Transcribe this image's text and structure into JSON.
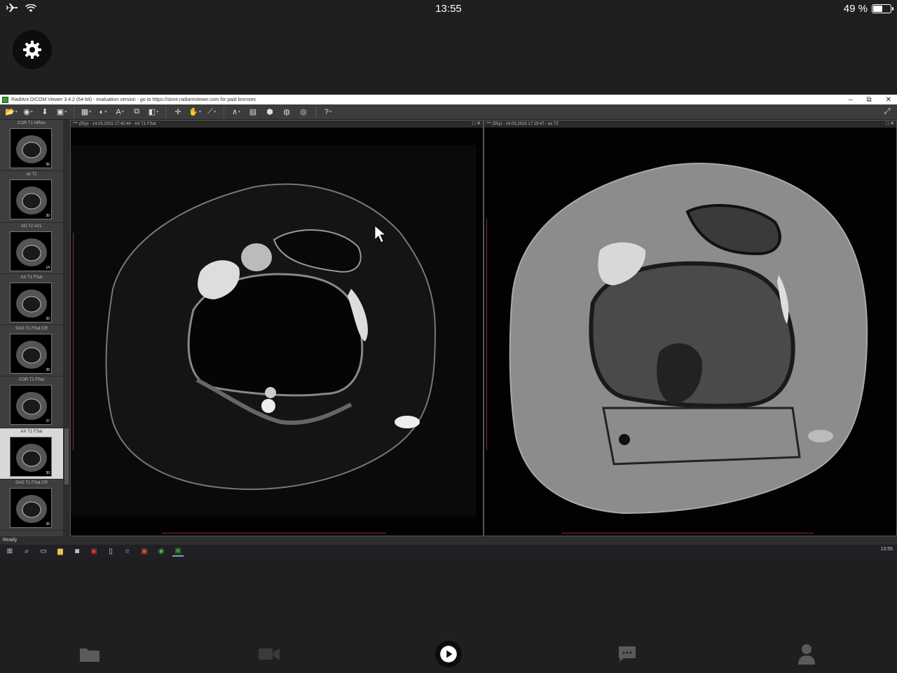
{
  "status_bar": {
    "time": "13:55",
    "battery": "49 %",
    "battery_level": 0.49
  },
  "window": {
    "title": "RadiAnt DICOM Viewer 3.4.2 (64-bit) - evaluation version - go to https://store.radiantviewer.com for paid licenses",
    "minimize": "–",
    "maximize": "⧉",
    "close": "✕"
  },
  "series": [
    {
      "label": "COR T1 HiRes",
      "count": "35",
      "active": false
    },
    {
      "label": "ax T2",
      "count": "30",
      "active": false
    },
    {
      "label": "SG T2 ACL",
      "count": "14",
      "active": false
    },
    {
      "label": "AX T1 FSat",
      "count": "30",
      "active": false
    },
    {
      "label": "SAG T1 FSat CR",
      "count": "35",
      "active": false
    },
    {
      "label": "COR T1 FSat",
      "count": "37",
      "active": false
    },
    {
      "label": "AX T1 FSat",
      "count": "30",
      "active": true
    },
    {
      "label": "SAG T1 FSat CR",
      "count": "35",
      "active": false
    }
  ],
  "viewports": {
    "left": {
      "header": "*** (55y) - 14.03.2015 17:42:44 - AX T1 FSat"
    },
    "right": {
      "header": "*** (55y) - 14.03.2015 17:19:47 - ax T2"
    },
    "restore": "□",
    "close": "✕"
  },
  "statusbar": {
    "text": "Ready"
  },
  "taskbar": {
    "clock": "13:55"
  },
  "colors": {
    "ruler": "#8a2b2b",
    "background": "#1f1f21"
  }
}
